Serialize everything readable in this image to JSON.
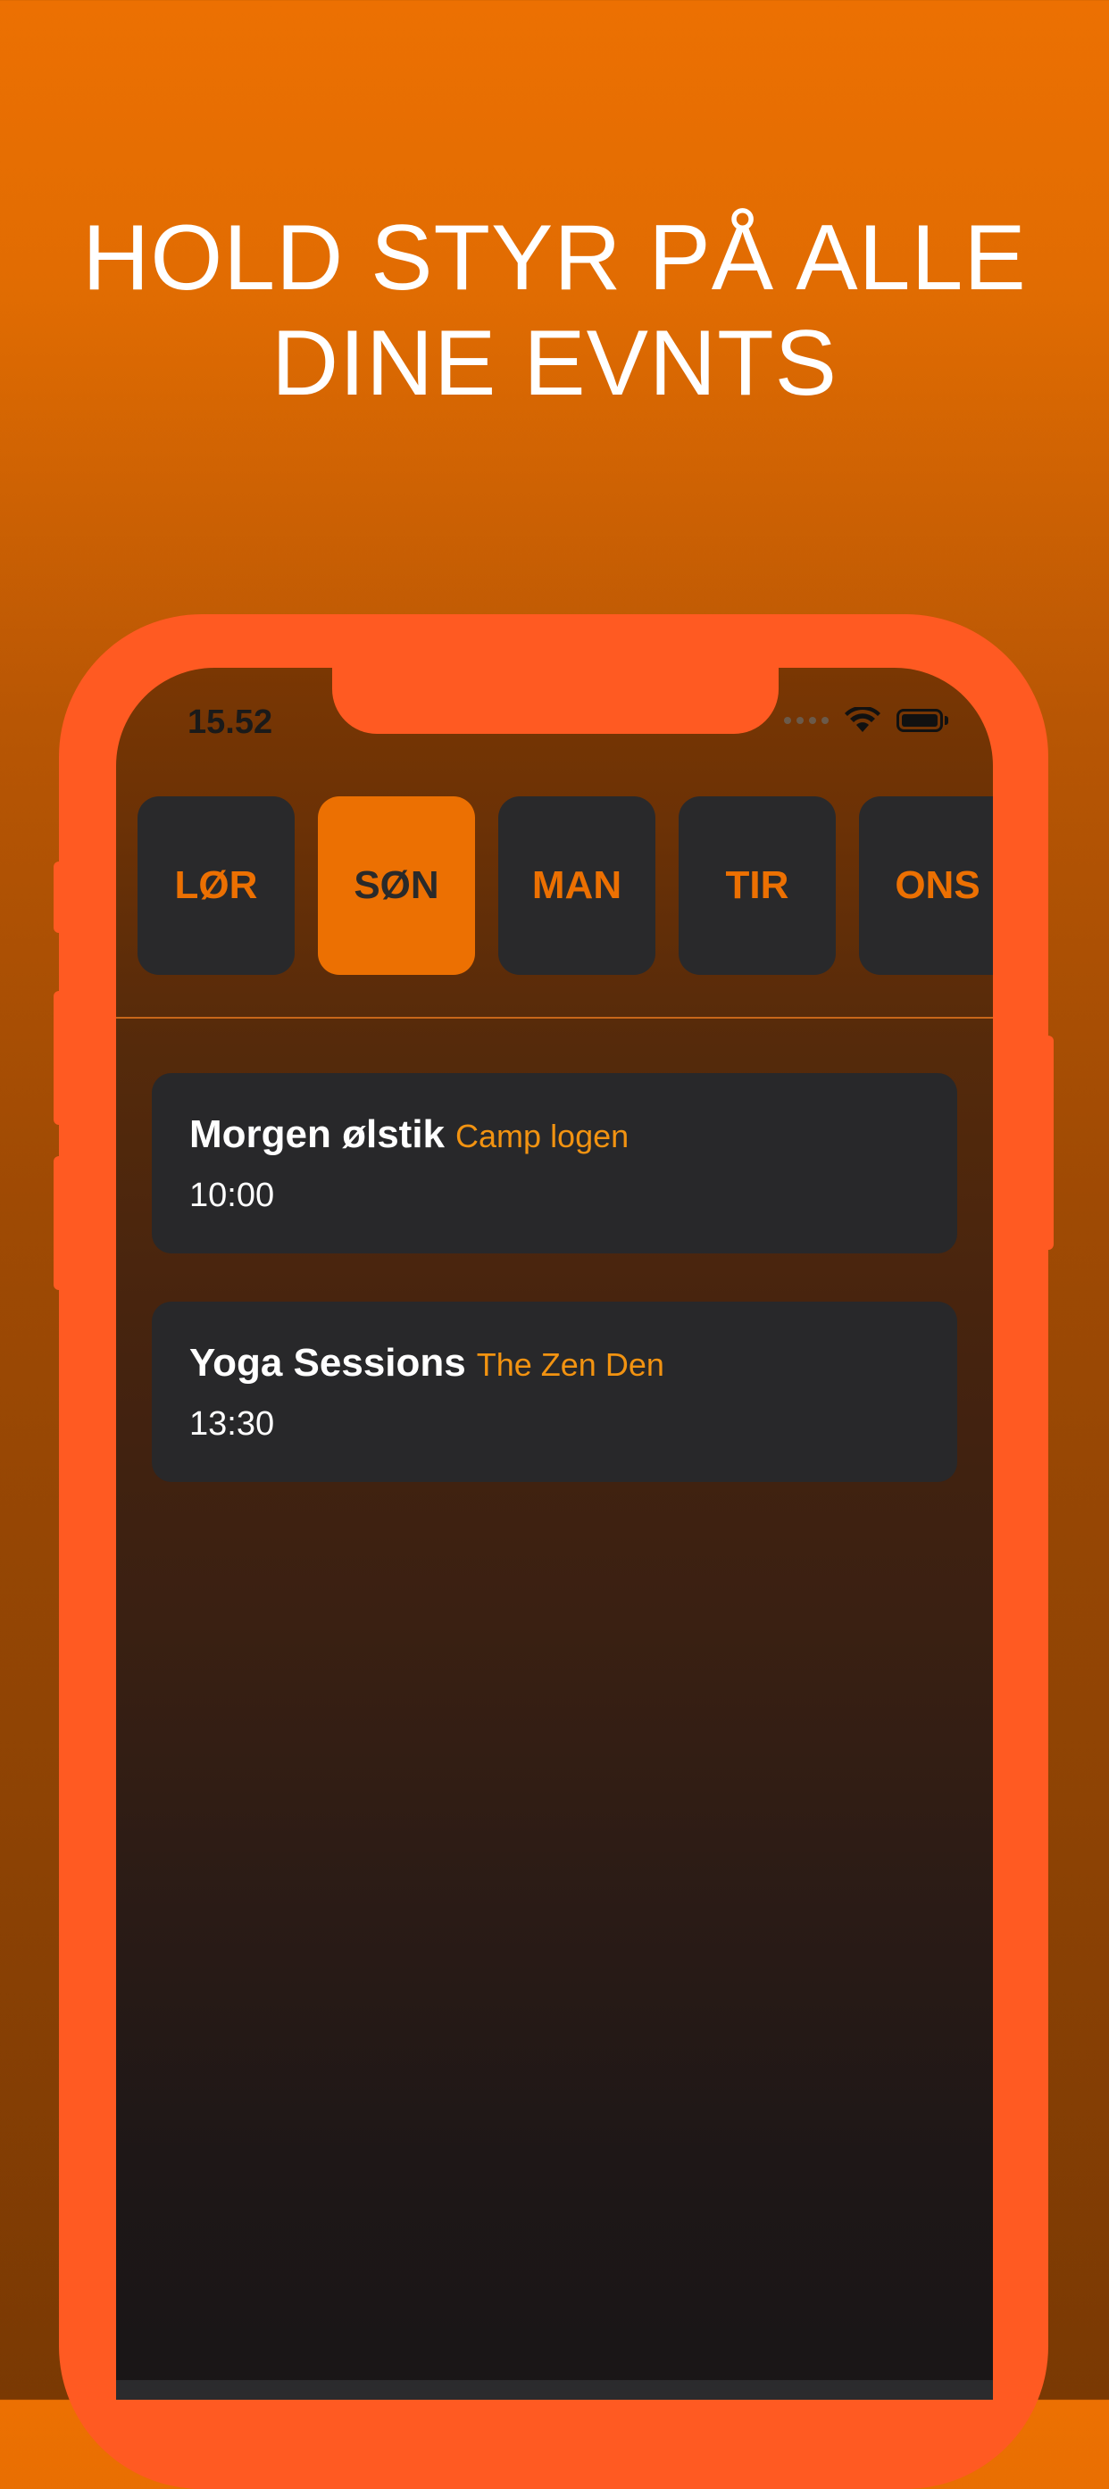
{
  "headline": {
    "line1": "HOLD STYR PÅ ALLE",
    "line2": "DINE EVNTS"
  },
  "status_bar": {
    "time": "15.52",
    "icons": [
      "signal-dots-icon",
      "wifi-icon",
      "battery-icon"
    ]
  },
  "days": [
    {
      "label": "LØR",
      "active": false
    },
    {
      "label": "SØN",
      "active": true
    },
    {
      "label": "MAN",
      "active": false
    },
    {
      "label": "TIR",
      "active": false
    },
    {
      "label": "ONS",
      "active": false
    }
  ],
  "events": [
    {
      "title": "Morgen ølstik",
      "venue": "Camp logen",
      "time": "10:00"
    },
    {
      "title": "Yoga Sessions",
      "venue": "The Zen Den",
      "time": "13:30"
    }
  ],
  "colors": {
    "accent": "#ec7002",
    "phone_frame": "#ff5a22",
    "card": "#28282a",
    "venue_text": "#f29311"
  }
}
